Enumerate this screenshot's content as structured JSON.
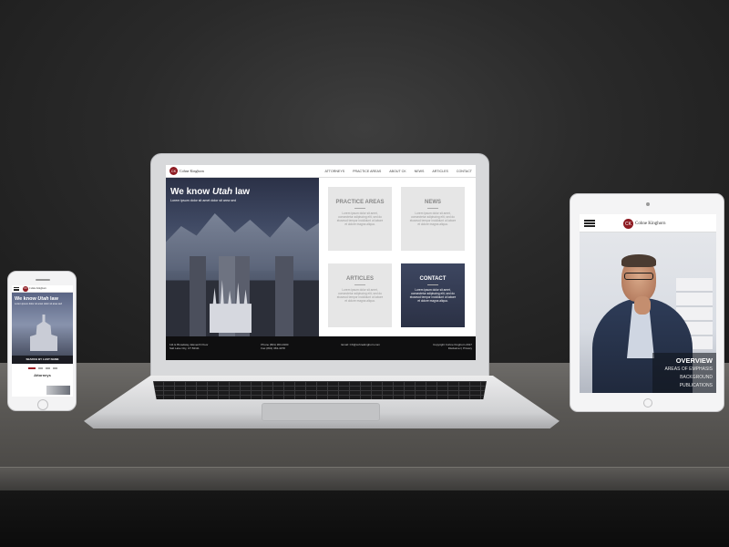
{
  "brand": {
    "logo_mark": "CK",
    "logo_text": "Cohne Kinghorn"
  },
  "laptop": {
    "nav_items": [
      "Attorneys",
      "Practice Areas",
      "About CK",
      "News",
      "Articles",
      "Contact"
    ],
    "hero": {
      "title_pre": "We know ",
      "title_em": "Utah",
      "title_post": " law",
      "subtitle": "Lorem ipsum dolor sit amet dolor sit area sed"
    },
    "tiles": [
      {
        "title": "PRACTICE AREAS",
        "text": "Lorem ipsum dolor sit amet, consectetur adipiscing elit, sed do eiusmod tempor incididunt ut labore et dolore magna aliqua."
      },
      {
        "title": "NEWS",
        "text": "Lorem ipsum dolor sit amet, consectetur adipiscing elit, sed do eiusmod tempor incididunt ut labore et dolore magna aliqua."
      },
      {
        "title": "ARTICLES",
        "text": "Lorem ipsum dolor sit amet, consectetur adipiscing elit, sed do eiusmod tempor incididunt ut labore et dolore magna aliqua."
      },
      {
        "title": "CONTACT",
        "text": "Lorem ipsum dolor sit amet, consectetur adipiscing elit, sed do eiusmod tempor incididunt ut labore et dolore magna aliqua."
      }
    ],
    "footer": {
      "address": "111 E Broadway, Eleventh Floor\nSalt Lake City, UT 84111",
      "phone": "Phone (801) 363-4300\nFax (801) 363-4378",
      "email": "Email: CK@cohnekinghorn.com",
      "copyright": "Copyright Cohne Kinghorn 2017\nDisclaimer | Privacy"
    }
  },
  "phone": {
    "hero": {
      "title_pre": "We know ",
      "title_em": "Utah",
      "title_post": " law",
      "subtitle": "Lorem ipsum dolor sit amet dolor sit area sed"
    },
    "search_label": "SEARCH BY LAST NAME",
    "section_title": "Attorneys"
  },
  "tablet": {
    "menu": {
      "main": "OVERVIEW",
      "items": [
        "AREAS OF EMPHASIS",
        "BACKGROUND",
        "PUBLICATIONS"
      ]
    }
  },
  "colors": {
    "brand_red": "#9d1f27",
    "wall": "#2a2a2a",
    "footer": "#0f0f10"
  }
}
